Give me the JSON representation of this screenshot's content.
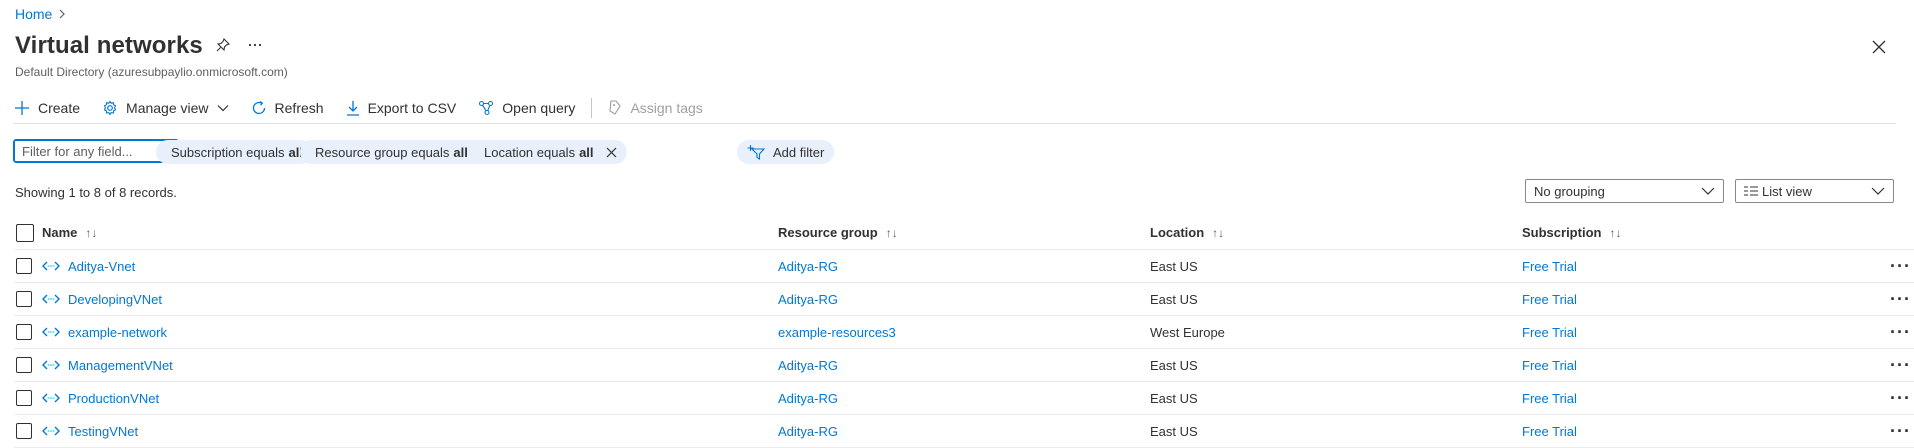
{
  "breadcrumb": {
    "home": "Home"
  },
  "page": {
    "title": "Virtual networks",
    "subtitle": "Default Directory (azuresubpaylio.onmicrosoft.com)"
  },
  "toolbar": {
    "create": "Create",
    "manage_view": "Manage view",
    "refresh": "Refresh",
    "export_csv": "Export to CSV",
    "open_query": "Open query",
    "assign_tags": "Assign tags"
  },
  "filter": {
    "placeholder": "Filter for any field...",
    "pills": [
      {
        "prefix": "Subscription equals",
        "value": "all"
      },
      {
        "prefix": "Resource group equals",
        "value": "all"
      },
      {
        "prefix": "Location equals",
        "value": "all"
      }
    ],
    "add_filter": "Add filter"
  },
  "records_text": "Showing 1 to 8 of 8 records.",
  "grouping": {
    "selected": "No grouping"
  },
  "view": {
    "selected": "List view"
  },
  "table": {
    "columns": {
      "name": "Name",
      "resource_group": "Resource group",
      "location": "Location",
      "subscription": "Subscription"
    },
    "rows": [
      {
        "name": "Aditya-Vnet",
        "resource_group": "Aditya-RG",
        "location": "East US",
        "subscription": "Free Trial"
      },
      {
        "name": "DevelopingVNet",
        "resource_group": "Aditya-RG",
        "location": "East US",
        "subscription": "Free Trial"
      },
      {
        "name": "example-network",
        "resource_group": "example-resources3",
        "location": "West Europe",
        "subscription": "Free Trial"
      },
      {
        "name": "ManagementVNet",
        "resource_group": "Aditya-RG",
        "location": "East US",
        "subscription": "Free Trial"
      },
      {
        "name": "ProductionVNet",
        "resource_group": "Aditya-RG",
        "location": "East US",
        "subscription": "Free Trial"
      },
      {
        "name": "TestingVNet",
        "resource_group": "Aditya-RG",
        "location": "East US",
        "subscription": "Free Trial"
      }
    ]
  },
  "colors": {
    "accent": "#0078d4",
    "pill_bg": "#e8f0fb",
    "vnet_icon": "#0078d4"
  },
  "icons": [
    "chevron-right-icon",
    "pin-icon",
    "ellipsis-icon",
    "close-icon",
    "plus-icon",
    "gear-icon",
    "chevron-down-icon",
    "refresh-icon",
    "download-icon",
    "query-icon",
    "tag-icon",
    "filter-add-icon",
    "vnet-icon",
    "more-icon"
  ]
}
